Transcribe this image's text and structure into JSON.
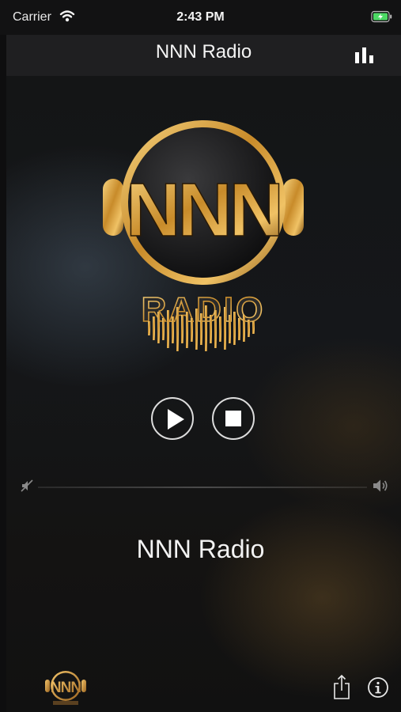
{
  "status_bar": {
    "carrier": "Carrier",
    "time": "2:43 PM",
    "wifi_icon": "wifi-icon",
    "battery_icon": "battery-charging-icon"
  },
  "nav": {
    "title": "NNN Radio",
    "right_icon": "bar-chart-icon"
  },
  "artwork": {
    "logo_letters": "NNN",
    "logo_word": "RADIO"
  },
  "controls": {
    "play_icon": "play-icon",
    "stop_icon": "stop-icon"
  },
  "volume": {
    "min_icon": "speaker-muted-icon",
    "max_icon": "speaker-loud-icon"
  },
  "now_playing": {
    "station": "NNN Radio"
  },
  "footer": {
    "mini_logo_text": "NNN",
    "share_icon": "share-icon",
    "info_icon": "info-icon"
  },
  "colors": {
    "gold": "#c9922f",
    "gold_light": "#f3c46a",
    "background": "#141516",
    "navbar": "#1f1f21"
  }
}
